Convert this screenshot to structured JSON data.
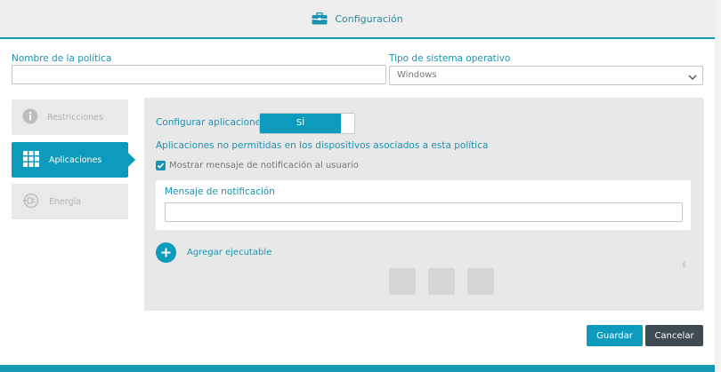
{
  "window": {
    "title": "Configuración",
    "icon": "briefcase-icon"
  },
  "form": {
    "policy_name_label": "Nombre de la política",
    "policy_name_value": "",
    "os_label": "Tipo de sistema operativo",
    "os_selected": "Windows"
  },
  "sidebar": {
    "items": [
      {
        "label": "Restricciones",
        "icon": "info-icon",
        "active": false
      },
      {
        "label": "Aplicaciones",
        "icon": "grid-icon",
        "active": true
      },
      {
        "label": "Energía",
        "icon": "power-plug-icon",
        "active": false
      }
    ]
  },
  "panel": {
    "configure_label": "Configurar aplicaciones",
    "toggle_value": "SÍ",
    "subtitle": "Aplicaciones no permitidas en los dispositivos asociados a esta política",
    "show_notification_label": "Mostrar mensaje de notificación al usuario",
    "show_notification_checked": true,
    "message_label": "Mensaje de notificación",
    "message_value": "",
    "add_executable_label": "Agregar ejecutable"
  },
  "footer": {
    "save_label": "Guardar",
    "cancel_label": "Cancelar"
  },
  "colors": {
    "accent": "#0d9bbd",
    "label": "#1a93b1",
    "dark_button": "#3f4b52"
  }
}
